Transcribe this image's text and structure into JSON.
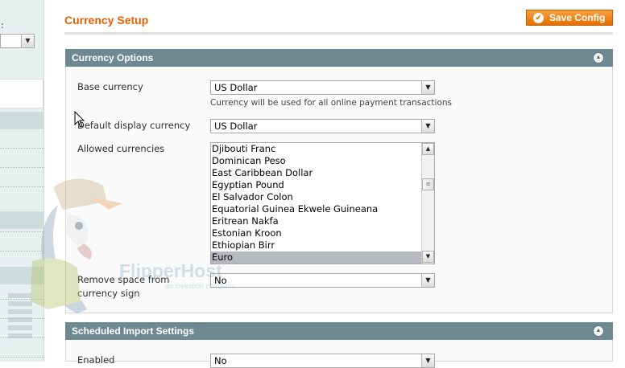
{
  "sidebar": {
    "colon": ":"
  },
  "header": {
    "title": "Currency Setup",
    "save_label": "Save Config"
  },
  "currency_options": {
    "title": "Currency Options",
    "base_currency": {
      "label": "Base currency",
      "value": "US Dollar",
      "note": "Currency will be used for all online payment transactions"
    },
    "default_display_currency": {
      "label": "Default display currency",
      "value": "US Dollar"
    },
    "allowed_currencies": {
      "label": "Allowed currencies",
      "options": [
        "Djibouti Franc",
        "Dominican Peso",
        "East Caribbean Dollar",
        "Egyptian Pound",
        "El Salvador Colon",
        "Equatorial Guinea Ekwele Guineana",
        "Eritrean Nakfa",
        "Estonian Kroon",
        "Ethiopian Birr",
        "Euro"
      ],
      "selected": "Euro"
    },
    "remove_space": {
      "label": "Remove space from currency sign",
      "value": "No"
    }
  },
  "scheduled_import": {
    "title": "Scheduled Import Settings",
    "enabled": {
      "label": "Enabled",
      "value": "No"
    }
  },
  "watermark": {
    "brand": "FlipperHost",
    "tagline": "an investion company",
    "mascot_cap": "FLIPPER HOST"
  },
  "colors": {
    "accent": "#eb5e00",
    "section_header": "#6f8992",
    "selected_option": "#b8b8c0"
  }
}
